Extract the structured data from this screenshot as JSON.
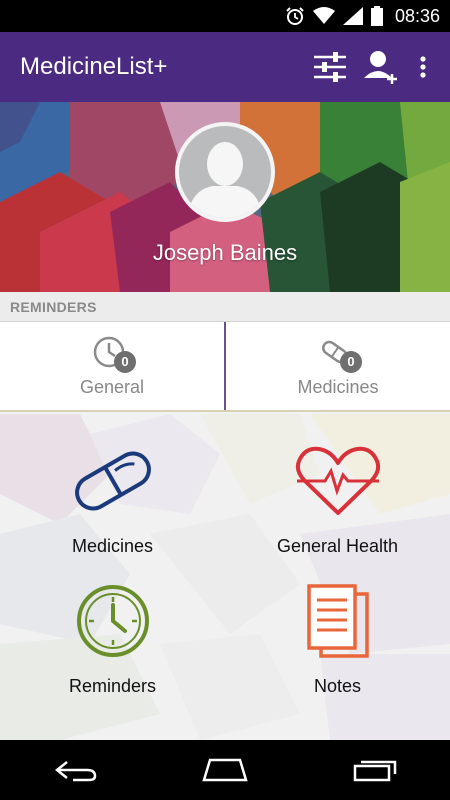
{
  "status_bar": {
    "time": "08:36",
    "icons": [
      "alarm-icon",
      "wifi-icon",
      "signal-icon",
      "battery-icon"
    ]
  },
  "app_bar": {
    "title": "MedicineList+",
    "color": "#4b2a82",
    "actions": [
      "filter-settings-icon",
      "add-person-icon",
      "more-vert-icon"
    ]
  },
  "profile": {
    "name": "Joseph Baines"
  },
  "reminders": {
    "header": "REMINDERS",
    "cards": [
      {
        "label": "General",
        "count": "0",
        "icon": "clock-icon"
      },
      {
        "label": "Medicines",
        "count": "0",
        "icon": "pill-icon"
      }
    ]
  },
  "grid": {
    "tiles": [
      {
        "label": "Medicines",
        "icon": "capsule-icon",
        "color": "#1a3a7c"
      },
      {
        "label": "General Health",
        "icon": "heart-pulse-icon",
        "color": "#d9313a"
      },
      {
        "label": "Reminders",
        "icon": "clock-icon",
        "color": "#6a8f2a"
      },
      {
        "label": "Notes",
        "icon": "notes-icon",
        "color": "#e8663a"
      }
    ]
  },
  "nav_bar": {
    "buttons": [
      "back-icon",
      "home-icon",
      "recent-apps-icon"
    ]
  }
}
